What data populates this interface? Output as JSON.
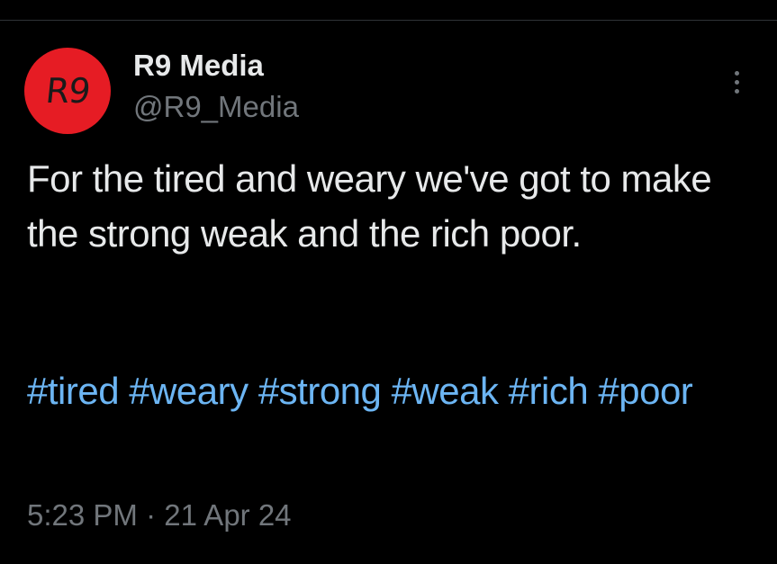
{
  "colors": {
    "background": "#000000",
    "primary_text": "#e7e9ea",
    "secondary_text": "#71767b",
    "hashtag": "#6cb5f3",
    "avatar_bg": "#e61c24"
  },
  "author": {
    "avatar_text": "R9",
    "display_name": "R9 Media",
    "handle": "@R9_Media"
  },
  "more_button": {
    "icon": "more-vertical-icon"
  },
  "tweet": {
    "text": "For the tired and weary we've got to make the strong weak and the rich poor.",
    "hashtags": [
      "#tired",
      "#weary",
      "#strong",
      "#weak",
      "#rich",
      "#poor"
    ]
  },
  "meta": {
    "time": "5:23 PM",
    "separator": "·",
    "date": "21 Apr 24"
  }
}
